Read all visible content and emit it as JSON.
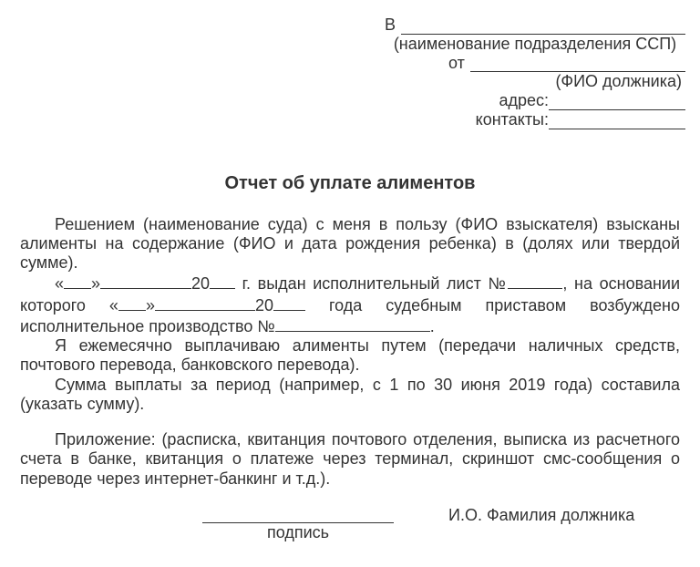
{
  "header": {
    "to_prefix": "В",
    "to_caption": "(наименование подразделения ССП)",
    "from_prefix": "от",
    "from_caption": "(ФИО должника)",
    "address_label": "адрес:",
    "contacts_label": "контакты:"
  },
  "title": "Отчет об уплате алиментов",
  "body": {
    "p1": "Решением (наименование суда) с меня в пользу (ФИО взыскателя) взысканы алименты на содержание (ФИО и дата рождения ребенка) в (долях или твердой сумме).",
    "p2_a": "«",
    "p2_b": "»",
    "p2_c": "20",
    "p2_d": " г. выдан исполнительный лист №",
    "p2_e": ", на основании которого «",
    "p2_f": "»",
    "p2_g": "20",
    "p2_h": " года судебным приставом возбуждено исполнительное производство №",
    "p2_i": ".",
    "p3": "Я ежемесячно выплачиваю алименты путем (передачи наличных средств, почтового перевода, банковского перевода).",
    "p4": "Сумма выплаты за период (например, с 1 по 30 июня 2019 года) составила (указать сумму).",
    "p5": "Приложение: (расписка, квитанция почтового отделения, выписка из расчетного счета в банке, квитанция о платеже через терминал, скриншот смс-сообщения о переводе через интернет-банкинг и т.д.)."
  },
  "signature": {
    "label": "подпись",
    "name": "И.О. Фамилия должника"
  }
}
